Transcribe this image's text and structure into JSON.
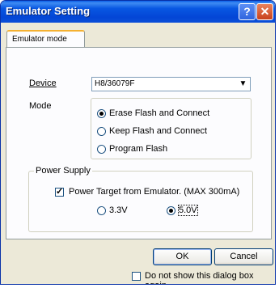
{
  "window": {
    "title": "Emulator Setting",
    "help_glyph": "?",
    "close_glyph": "✕"
  },
  "tabs": [
    {
      "label": "Emulator mode",
      "active": true
    }
  ],
  "device": {
    "label": "Device",
    "value": "H8/36079F"
  },
  "mode": {
    "label": "Mode",
    "options": [
      {
        "label": "Erase Flash and Connect",
        "checked": true
      },
      {
        "label": "Keep Flash and Connect",
        "checked": false
      },
      {
        "label": "Program Flash",
        "checked": false
      }
    ]
  },
  "power_supply": {
    "group_label": "Power Supply",
    "checkbox_label": "Power Target from Emulator. (MAX 300mA)",
    "checked": true,
    "check_glyph": "✓",
    "voltages": [
      {
        "label": "3.3V",
        "checked": false
      },
      {
        "label": "5.0V",
        "checked": true
      }
    ]
  },
  "buttons": {
    "ok": "OK",
    "cancel": "Cancel"
  },
  "dont_show": {
    "label": "Do not show this dialog box again.",
    "checked": false
  },
  "icons": {
    "dropdown": "▼"
  }
}
